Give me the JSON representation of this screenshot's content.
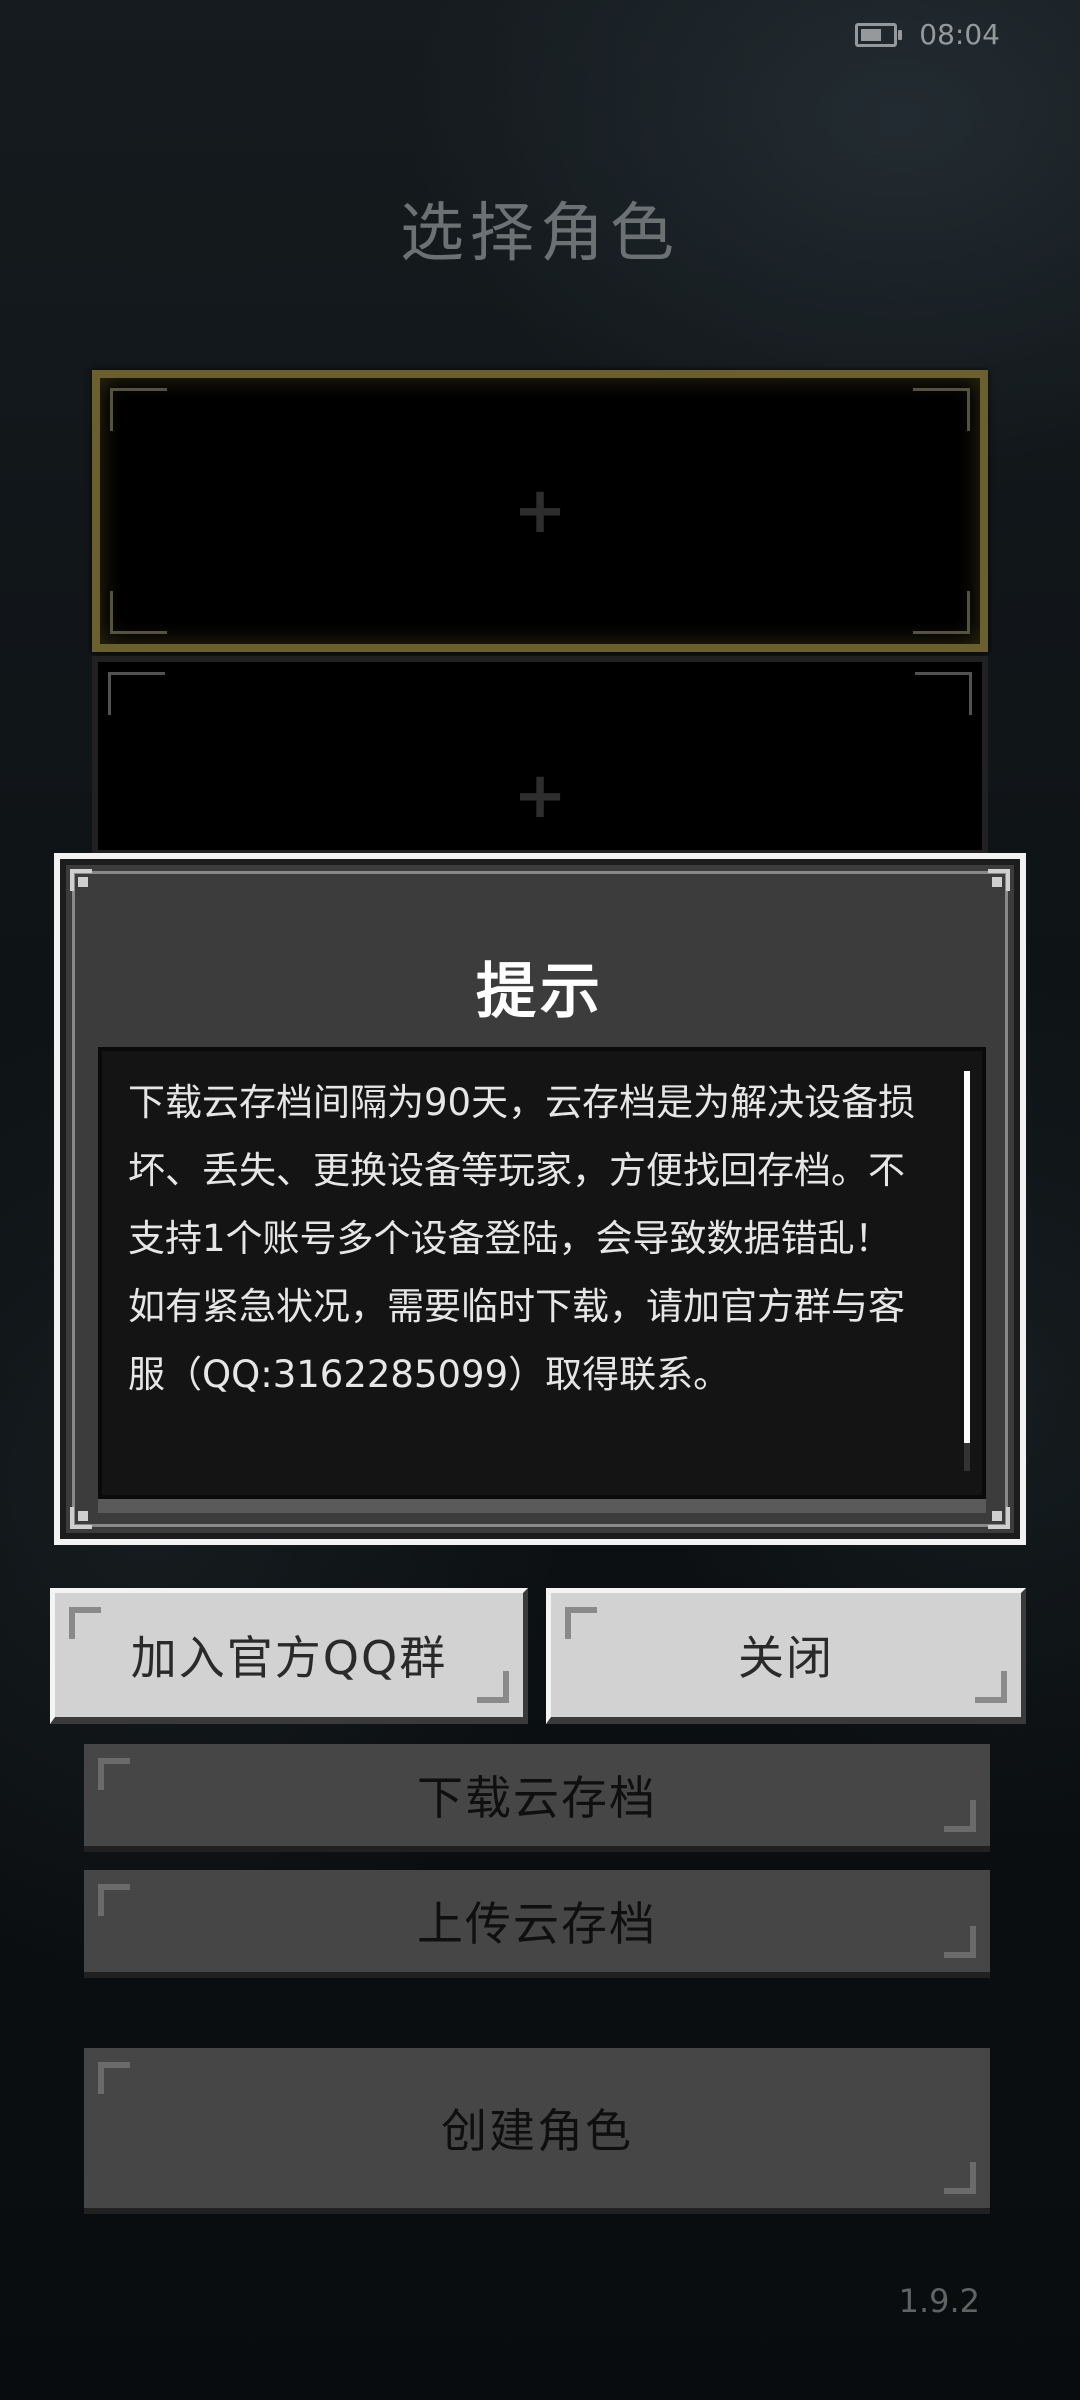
{
  "status_bar": {
    "time": "08:04",
    "battery_level": 0.55
  },
  "page": {
    "title": "选择角色",
    "version": "1.9.2"
  },
  "slots": [
    {
      "icon": "plus-icon",
      "symbol": "+"
    },
    {
      "icon": "plus-icon",
      "symbol": "+"
    }
  ],
  "buttons": {
    "download": "下载云存档",
    "upload": "上传云存档",
    "create": "创建角色"
  },
  "dialog": {
    "title": "提示",
    "paragraphs": [
      "下载云存档间隔为90天，云存档是为解决设备损坏、丢失、更换设备等玩家，方便找回存档。不支持1个账号多个设备登陆，会导致数据错乱！",
      "如有紧急状况，需要临时下载，请加官方群与客服（QQ:3162285099）取得联系。"
    ],
    "join_qq_label": "加入官方QQ群",
    "close_label": "关闭"
  }
}
